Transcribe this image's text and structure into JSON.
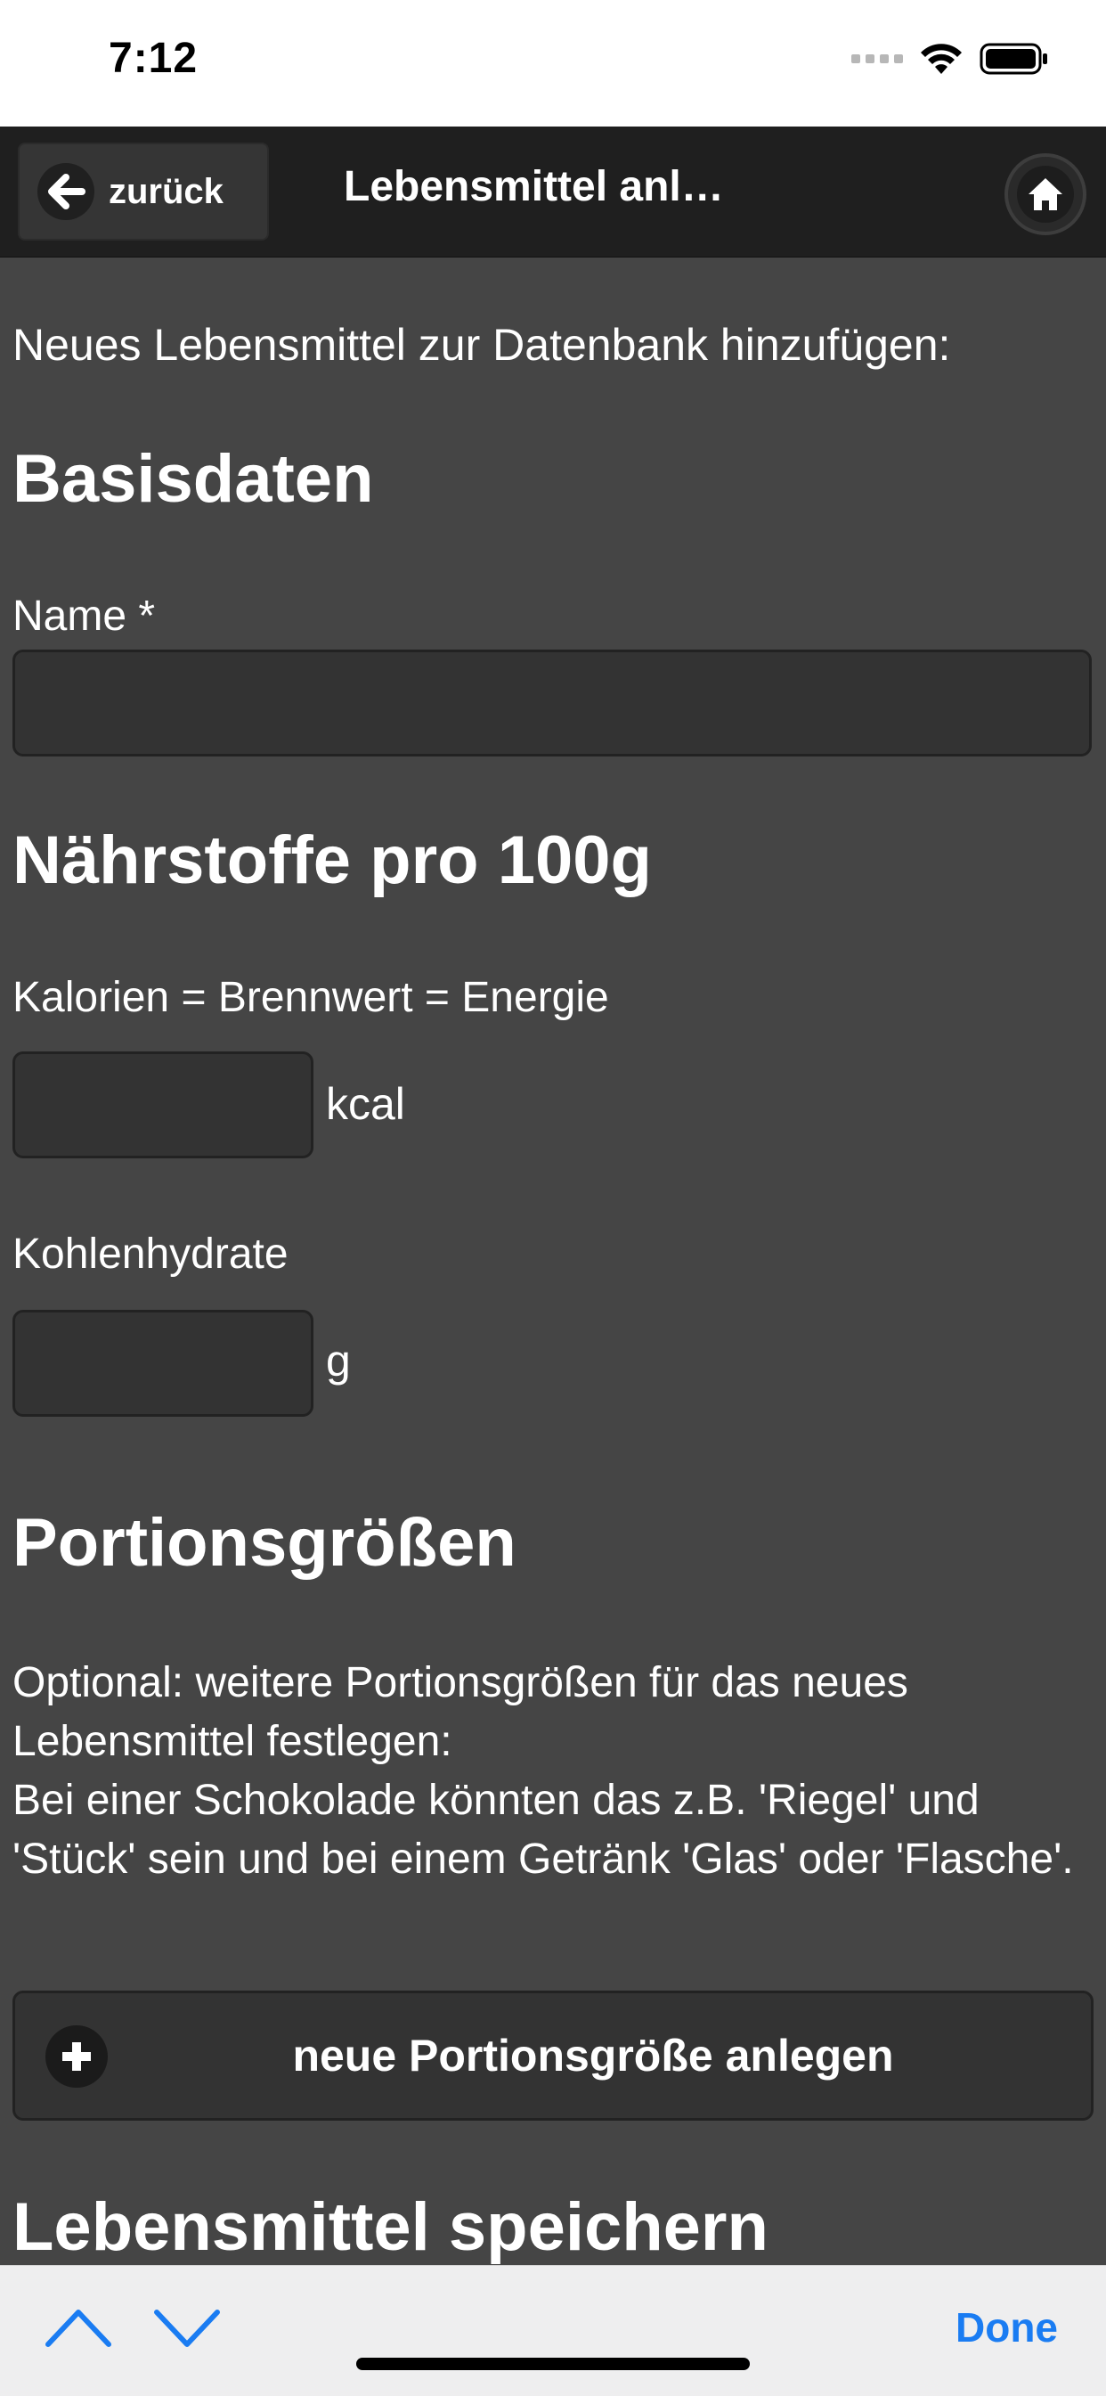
{
  "status_bar": {
    "time": "7:12"
  },
  "header": {
    "back_label": "zurück",
    "title": "Lebensmittel anl…",
    "home_icon": "home-icon"
  },
  "content": {
    "intro": "Neues Lebensmittel zur Datenbank hinzufügen:",
    "basisdaten": {
      "heading": "Basisdaten",
      "name_label": "Name *",
      "name_value": ""
    },
    "naehrstoffe": {
      "heading": "Nährstoffe pro 100g",
      "kalorien_label": "Kalorien = Brennwert = Energie",
      "kalorien_value": "",
      "kalorien_unit": "kcal",
      "kohlenhydrate_label": "Kohlenhydrate",
      "kohlenhydrate_value": "",
      "kohlenhydrate_unit": "g"
    },
    "portionen": {
      "heading": "Portionsgrößen",
      "text_line_1": "Optional: weitere Portionsgrößen für das neues Lebensmittel festlegen:",
      "text_line_2": "Bei einer Schokolade könnten das z.B. 'Riegel' und 'Stück' sein und bei einem Getränk 'Glas' oder 'Flasche'.",
      "add_button_label": "neue Portionsgröße anlegen"
    },
    "speichern": {
      "heading": "Lebensmittel speichern"
    }
  },
  "keyboard_bar": {
    "done_label": "Done"
  },
  "colors": {
    "background": "#454545",
    "header": "#1f1f1f",
    "field": "#333333",
    "done_blue": "#1a7cf2"
  }
}
